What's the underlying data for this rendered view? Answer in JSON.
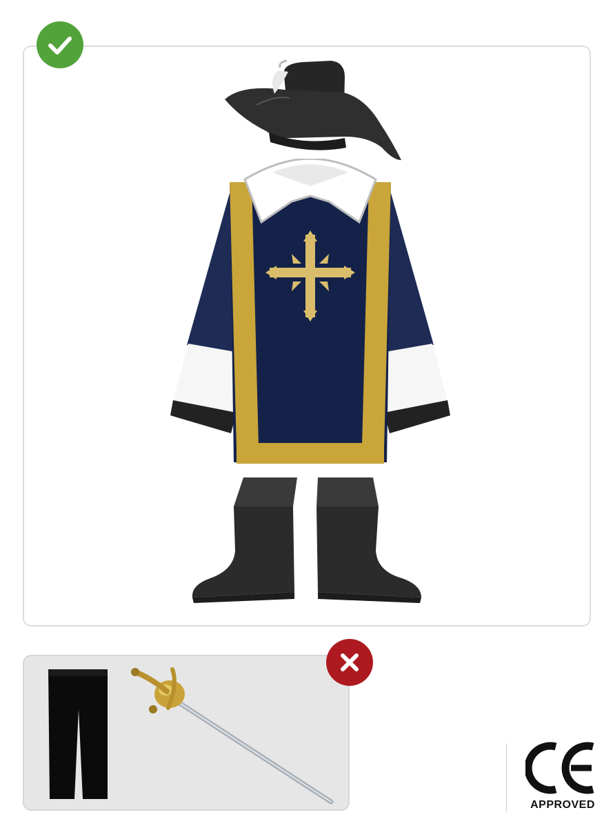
{
  "included": {
    "status": "included",
    "status_color": "#52a33a",
    "icon": "checkmark-icon",
    "items": [
      "hat-icon",
      "tunic-icon",
      "boot-cover-icon"
    ]
  },
  "excluded": {
    "status": "excluded",
    "status_color": "#ad1a1f",
    "icon": "cross-icon",
    "items": [
      "trousers-icon",
      "sword-icon"
    ]
  },
  "certification": {
    "mark": "CE",
    "label": "APPROVED"
  },
  "colors": {
    "tunic_blue": "#14224a",
    "gold_trim": "#c9a53a",
    "black_fabric": "#2b2b2b"
  }
}
